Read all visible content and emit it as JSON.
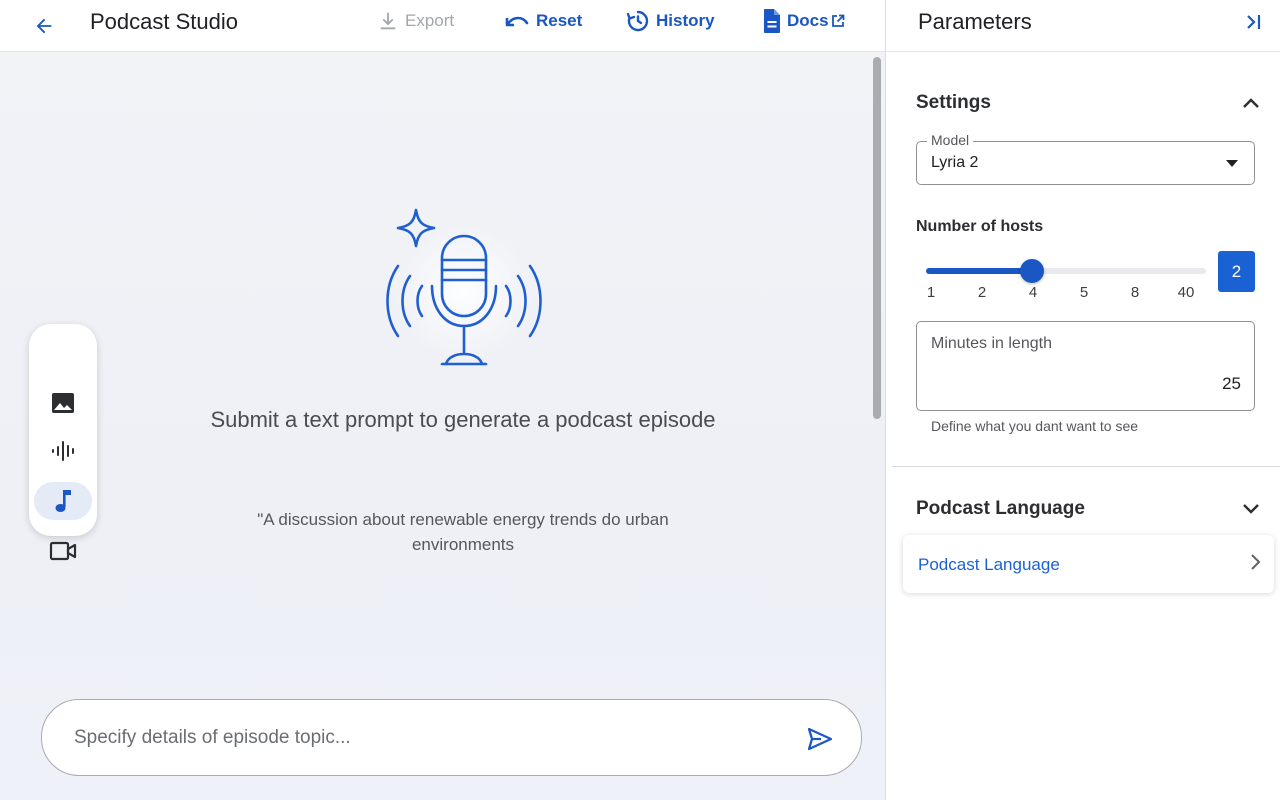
{
  "header": {
    "title": "Podcast Studio",
    "actions": {
      "export": "Export",
      "reset": "Reset",
      "history": "History",
      "docs": "Docs"
    }
  },
  "toolbar": {
    "items": [
      "image-icon",
      "audio-waveform-icon",
      "music-note-icon",
      "video-camera-icon"
    ],
    "active": "music-note-icon"
  },
  "main": {
    "empty_title": "Submit a text prompt to generate a podcast episode",
    "example_prompt": "\"A discussion about renewable energy trends do urban environments",
    "prompt_placeholder": "Specify details of episode topic...",
    "prompt_value": ""
  },
  "panel": {
    "title": "Parameters",
    "settings": {
      "title": "Settings",
      "model_label": "Model",
      "model_value": "Lyria 2",
      "hosts_label": "Number of hosts",
      "hosts_ticks": [
        "1",
        "2",
        "4",
        "5",
        "8",
        "40"
      ],
      "hosts_value": "2",
      "hosts_slider_fraction": 0.38,
      "minutes_label": "Minutes in length",
      "minutes_value": "25",
      "minutes_helper": "Define what you dant want to see"
    },
    "language": {
      "title": "Podcast Language",
      "option_label": "Podcast Language"
    }
  },
  "colors": {
    "accent": "#1a57c4",
    "chip": "#1a62d4",
    "disabled": "#a3a6ab",
    "canvas": "#f1f3f7"
  }
}
